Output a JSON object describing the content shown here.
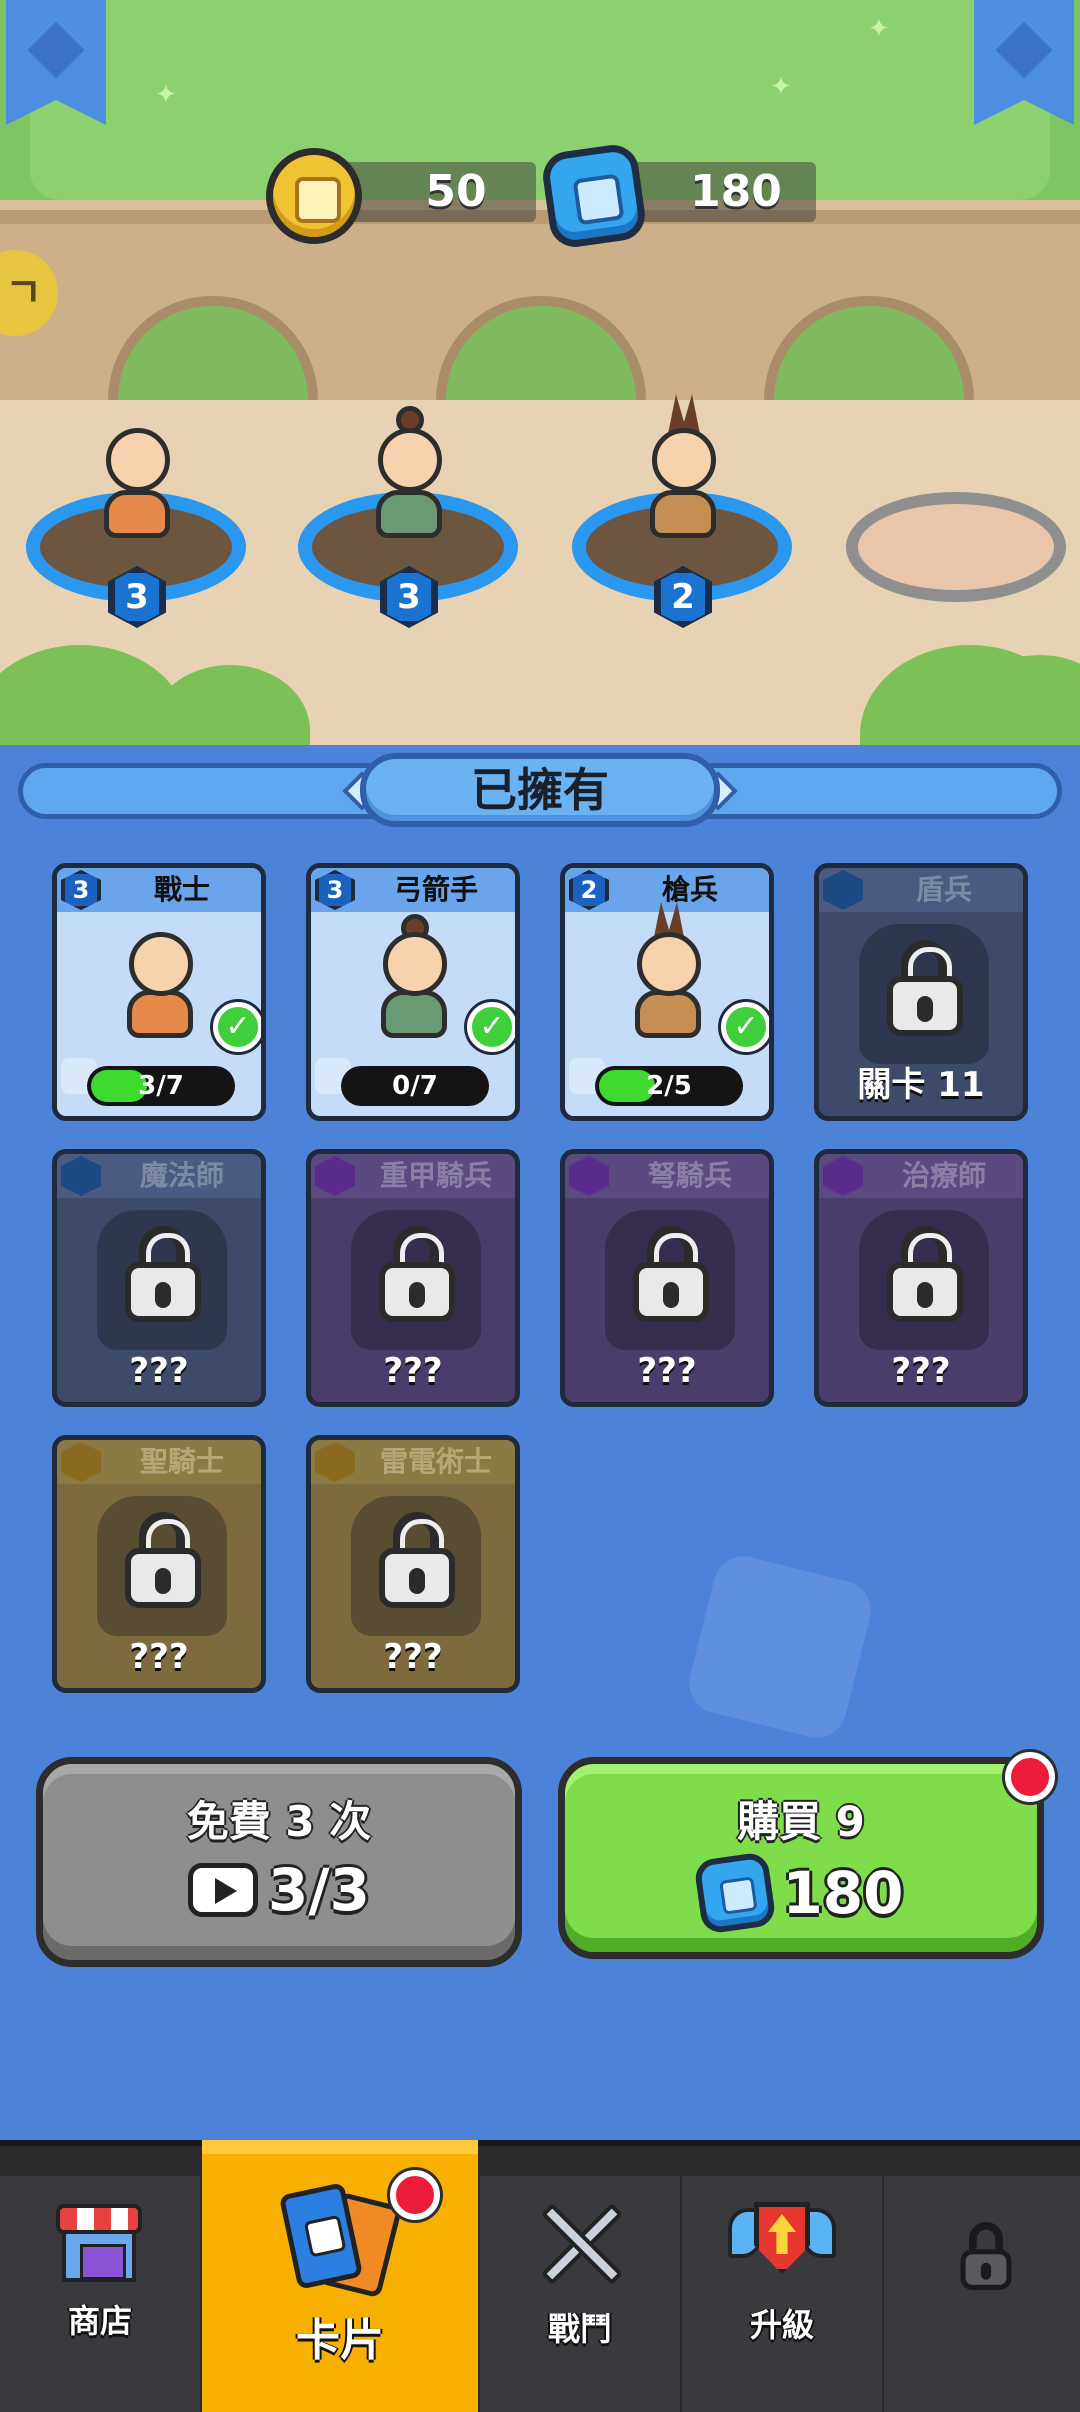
{
  "currency": {
    "coins": "50",
    "gems": "180"
  },
  "wall_sign": "ㄱ",
  "deployed_slots": [
    {
      "hero": "戰士",
      "level": "3"
    },
    {
      "hero": "弓箭手",
      "level": "3"
    },
    {
      "hero": "槍兵",
      "level": "2"
    },
    {
      "hero": "",
      "level": ""
    }
  ],
  "owned_header": "已擁有",
  "cards": [
    {
      "name": "戰士",
      "level": "3",
      "progress_text": "3/7",
      "progress": 0.43,
      "state": "owned",
      "selected": true
    },
    {
      "name": "弓箭手",
      "level": "3",
      "progress_text": "0/7",
      "progress": 0.0,
      "state": "owned",
      "selected": true
    },
    {
      "name": "槍兵",
      "level": "2",
      "progress_text": "2/5",
      "progress": 0.4,
      "state": "owned",
      "selected": true
    },
    {
      "name": "盾兵",
      "state": "locked",
      "bottom_text": "關卡 11",
      "rarity": "blue"
    },
    {
      "name": "魔法師",
      "state": "locked",
      "bottom_text": "???",
      "rarity": "blue"
    },
    {
      "name": "重甲騎兵",
      "state": "locked",
      "bottom_text": "???",
      "rarity": "purple"
    },
    {
      "name": "弩騎兵",
      "state": "locked",
      "bottom_text": "???",
      "rarity": "purple"
    },
    {
      "name": "治療師",
      "state": "locked",
      "bottom_text": "???",
      "rarity": "purple"
    },
    {
      "name": "聖騎士",
      "state": "locked",
      "bottom_text": "???",
      "rarity": "gold"
    },
    {
      "name": "雷電術士",
      "state": "locked",
      "bottom_text": "???",
      "rarity": "gold"
    }
  ],
  "free_button": {
    "title": "免費 3 次",
    "value": "3/3",
    "icon": "video-play-icon"
  },
  "buy_button": {
    "title": "購買 9",
    "value": "180",
    "icon": "gem-icon",
    "has_notification": true
  },
  "nav": {
    "items": [
      {
        "label": "商店",
        "icon": "shop-icon",
        "active": false
      },
      {
        "label": "卡片",
        "icon": "cards-icon",
        "active": true,
        "has_notification": true
      },
      {
        "label": "戰鬥",
        "icon": "crossed-swords-icon",
        "active": false
      },
      {
        "label": "升級",
        "icon": "upgrade-shield-icon",
        "active": false
      },
      {
        "label": "",
        "icon": "lock-icon",
        "active": false
      }
    ]
  },
  "colors": {
    "panel_bg": "#4c83d8",
    "accent_green": "#7fdc4b",
    "nav_active": "#f8b000",
    "notification": "#ee1c3b"
  }
}
